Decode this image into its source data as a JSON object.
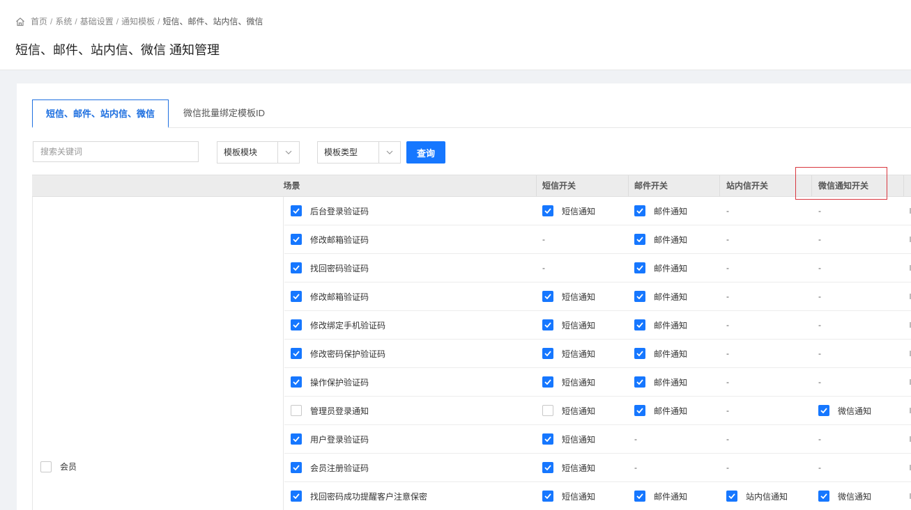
{
  "breadcrumb": {
    "items": [
      "首页",
      "系统",
      "基础设置",
      "通知模板"
    ],
    "current": "短信、邮件、站内信、微信",
    "separator": "/"
  },
  "page_title": "短信、邮件、站内信、微信 通知管理",
  "tabs": [
    {
      "label": "短信、邮件、站内信、微信",
      "active": true
    },
    {
      "label": "微信批量绑定模板ID",
      "active": false
    }
  ],
  "filters": {
    "search_placeholder": "搜索关键词",
    "module_select": "模板模块",
    "type_select": "模板类型",
    "query_button": "查询"
  },
  "table": {
    "headers": {
      "scene": "场景",
      "sms": "短信开关",
      "email": "邮件开关",
      "inbox": "站内信开关",
      "wechat": "微信通知开关"
    },
    "dash": "-",
    "group": {
      "label": "会员",
      "checked": false
    },
    "rows": [
      {
        "name": "后台登录验证码",
        "checked": true,
        "sms": {
          "label": "短信通知",
          "checked": true
        },
        "email": {
          "label": "邮件通知",
          "checked": true
        },
        "inbox": null,
        "wechat": null
      },
      {
        "name": "修改邮箱验证码",
        "checked": true,
        "sms": null,
        "email": {
          "label": "邮件通知",
          "checked": true
        },
        "inbox": null,
        "wechat": null
      },
      {
        "name": "找回密码验证码",
        "checked": true,
        "sms": null,
        "email": {
          "label": "邮件通知",
          "checked": true
        },
        "inbox": null,
        "wechat": null
      },
      {
        "name": "修改邮箱验证码",
        "checked": true,
        "sms": {
          "label": "短信通知",
          "checked": true
        },
        "email": {
          "label": "邮件通知",
          "checked": true
        },
        "inbox": null,
        "wechat": null
      },
      {
        "name": "修改绑定手机验证码",
        "checked": true,
        "sms": {
          "label": "短信通知",
          "checked": true
        },
        "email": {
          "label": "邮件通知",
          "checked": true
        },
        "inbox": null,
        "wechat": null
      },
      {
        "name": "修改密码保护验证码",
        "checked": true,
        "sms": {
          "label": "短信通知",
          "checked": true
        },
        "email": {
          "label": "邮件通知",
          "checked": true
        },
        "inbox": null,
        "wechat": null
      },
      {
        "name": "操作保护验证码",
        "checked": true,
        "sms": {
          "label": "短信通知",
          "checked": true
        },
        "email": {
          "label": "邮件通知",
          "checked": true
        },
        "inbox": null,
        "wechat": null
      },
      {
        "name": "管理员登录通知",
        "checked": false,
        "sms": {
          "label": "短信通知",
          "checked": false
        },
        "email": {
          "label": "邮件通知",
          "checked": true
        },
        "inbox": null,
        "wechat": {
          "label": "微信通知",
          "checked": true
        }
      },
      {
        "name": "用户登录验证码",
        "checked": true,
        "sms": {
          "label": "短信通知",
          "checked": true
        },
        "email": null,
        "inbox": null,
        "wechat": null
      },
      {
        "name": "会员注册验证码",
        "checked": true,
        "sms": {
          "label": "短信通知",
          "checked": true
        },
        "email": null,
        "inbox": null,
        "wechat": null
      },
      {
        "name": "找回密码成功提醒客户注意保密",
        "checked": true,
        "sms": {
          "label": "短信通知",
          "checked": true
        },
        "email": {
          "label": "邮件通知",
          "checked": true
        },
        "inbox": {
          "label": "站内信通知",
          "checked": true
        },
        "wechat": {
          "label": "微信通知",
          "checked": true
        }
      }
    ]
  },
  "colors": {
    "accent": "#1677ff",
    "highlight": "#d9363e"
  }
}
